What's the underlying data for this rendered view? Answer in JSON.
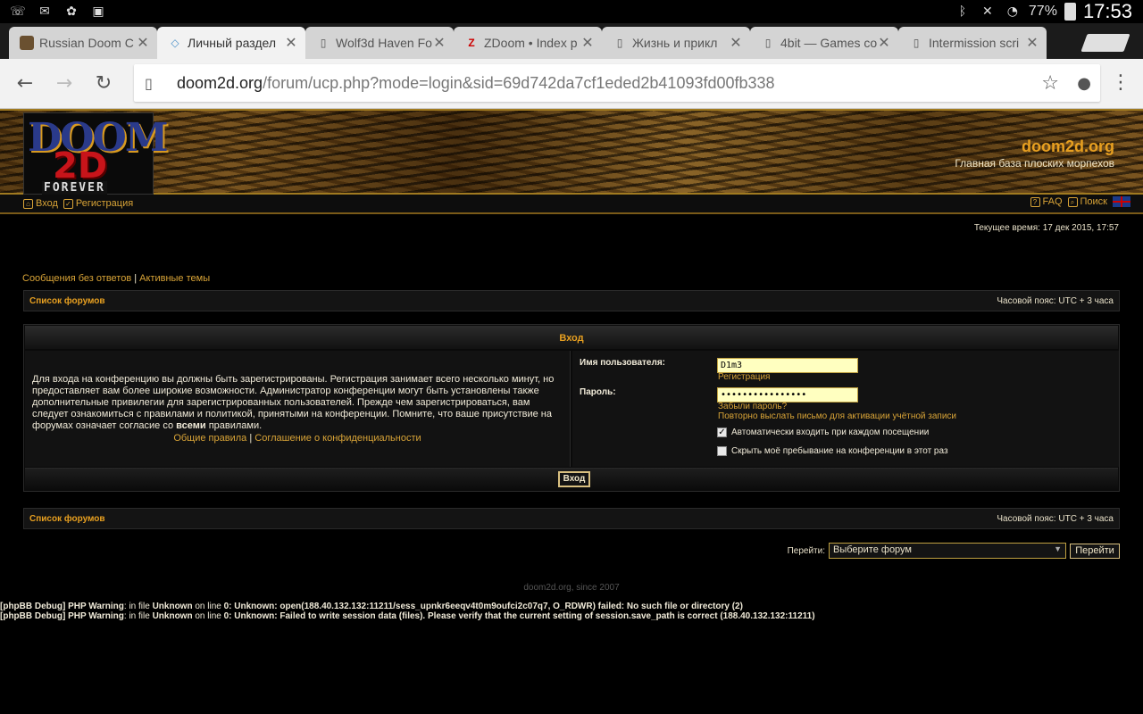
{
  "status_bar": {
    "battery": "77%",
    "time": "17:53"
  },
  "tabs": [
    {
      "title": "Russian Doom C",
      "icon": "doom-favicon"
    },
    {
      "title": "Личный раздел",
      "icon": "diamond-favicon"
    },
    {
      "title": "Wolf3d Haven Fo",
      "icon": "page-icon"
    },
    {
      "title": "ZDoom • Index p",
      "icon": "zdoom-favicon"
    },
    {
      "title": "Жизнь и прикл",
      "icon": "page-icon"
    },
    {
      "title": "4bit — Games co",
      "icon": "page-icon"
    },
    {
      "title": "Intermission scri",
      "icon": "page-icon"
    }
  ],
  "omnibox": {
    "domain": "doom2d.org",
    "path": "/forum/ucp.php?mode=login&sid=69d742da7cf1eded2b41093fd00fb338"
  },
  "site": {
    "title": "doom2d.org",
    "description": "Главная база плоских морпехов",
    "logo": {
      "doom": "DOOM",
      "twod": "2D",
      "forever": "FOREVER"
    }
  },
  "nav": {
    "login": "Вход",
    "register": "Регистрация",
    "faq": "FAQ",
    "search": "Поиск"
  },
  "current_time": "Текущее время: 17 дек 2015, 17:57",
  "quick_links": {
    "unanswered": "Сообщения без ответов",
    "separator": "|",
    "active": "Активные темы"
  },
  "breadcrumb": {
    "home": "Список форумов",
    "timezone": "Часовой пояс: UTC + 3 часа"
  },
  "login_panel": {
    "title": "Вход",
    "intro_text": "Для входа на конференцию вы должны быть зарегистрированы. Регистрация занимает всего несколько минут, но предоставляет вам более широкие возможности. Администратор конференции могут быть установлены также дополнительные привилегии для зарегистрированных пользователей. Прежде чем зарегистрироваться, вам следует ознакомиться с правилами и политикой, принятыми на конференции. Помните, что ваше присутствие на форумах означает согласие со",
    "intro_bold": "всеми",
    "intro_end": "правилами.",
    "rules_link": "Общие правила",
    "rules_sep": "|",
    "privacy_link": "Соглашение о конфиденциальности",
    "username_label": "Имя пользователя:",
    "username_value": "D1m3",
    "register_link": "Регистрация",
    "password_label": "Пароль:",
    "password_value": "••••••••••••••••",
    "forgot_link": "Забыли пароль?",
    "resend_link": "Повторно выслать письмо для активации учётной записи",
    "autologin_label": "Автоматически входить при каждом посещении",
    "autologin_checked": true,
    "hide_label": "Скрыть моё пребывание на конференции в этот раз",
    "hide_checked": false,
    "submit": "Вход"
  },
  "jump": {
    "label": "Перейти:",
    "selected": "Выберите форум",
    "button": "Перейти"
  },
  "footer": {
    "since": "doom2d.org, since 2007"
  },
  "debug": [
    {
      "prefix": "[phpBB Debug] PHP Warning",
      "mid1": ": in file ",
      "file": "Unknown",
      "mid2": " on line ",
      "line": "0",
      "msg": ": Unknown: open(188.40.132.132:11211/sess_upnkr6eeqv4t0m9oufci2c07q7, O_RDWR) failed: No such file or directory (2)"
    },
    {
      "prefix": "[phpBB Debug] PHP Warning",
      "mid1": ": in file ",
      "file": "Unknown",
      "mid2": " on line ",
      "line": "0",
      "msg": ": Unknown: Failed to write session data (files). Please verify that the current setting of session.save_path is correct (188.40.132.132:11211)"
    }
  ]
}
